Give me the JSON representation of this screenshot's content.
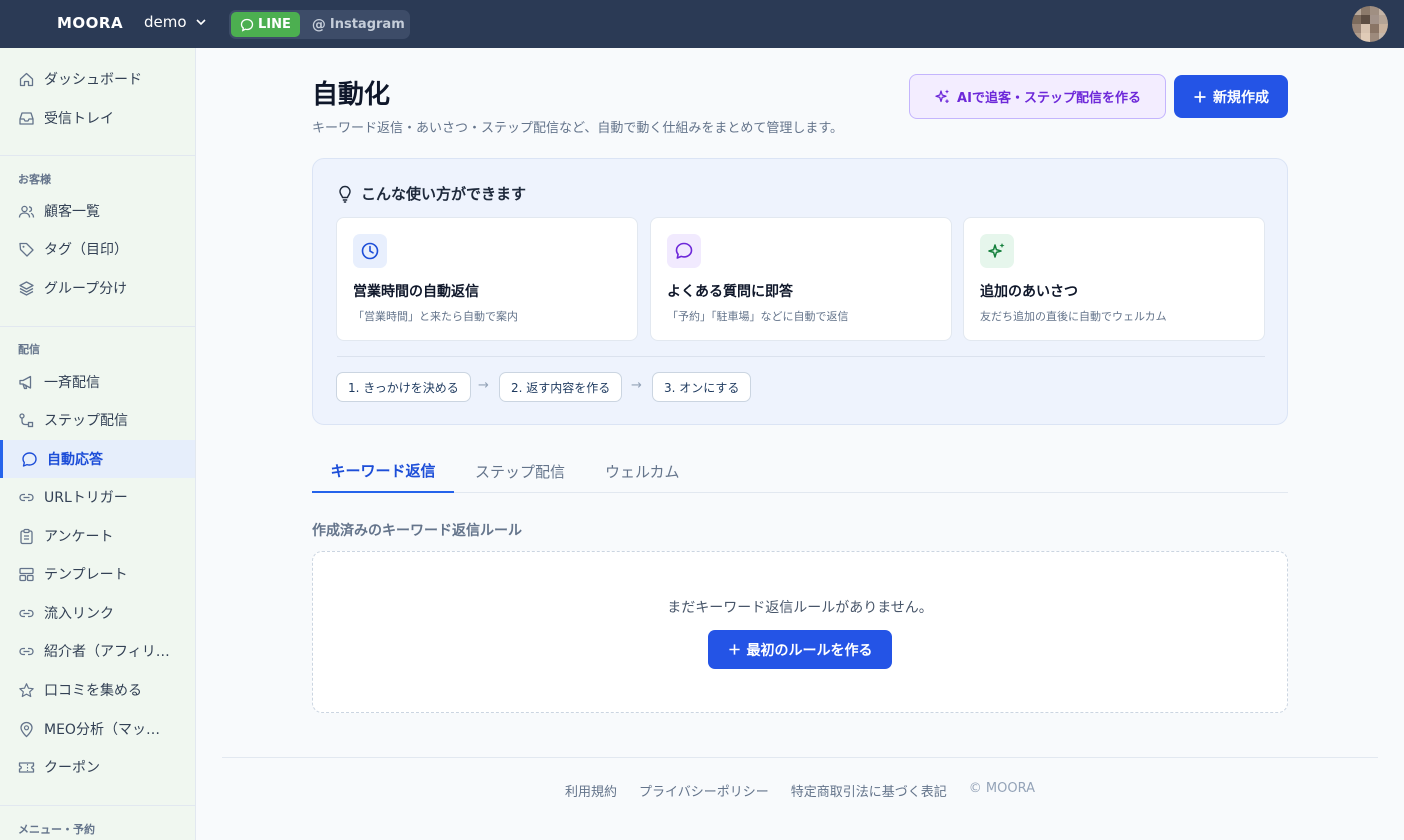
{
  "topbar": {
    "brand": "MOORA",
    "workspace": "demo",
    "channels": {
      "line": "LINE",
      "instagram": "Instagram"
    }
  },
  "sidebar": {
    "items_top": [
      {
        "label": "ダッシュボード",
        "icon": "home-icon"
      },
      {
        "label": "受信トレイ",
        "icon": "inbox-icon"
      }
    ],
    "section_customers": "お客様",
    "items_customers": [
      {
        "label": "顧客一覧",
        "icon": "users-icon"
      },
      {
        "label": "タグ（目印）",
        "icon": "tag-icon"
      },
      {
        "label": "グループ分け",
        "icon": "layers-icon"
      }
    ],
    "section_delivery": "配信",
    "items_delivery": [
      {
        "label": "一斉配信",
        "icon": "megaphone-icon"
      },
      {
        "label": "ステップ配信",
        "icon": "step-icon"
      },
      {
        "label": "自動応答",
        "icon": "chat-icon"
      },
      {
        "label": "URLトリガー",
        "icon": "link-icon"
      },
      {
        "label": "アンケート",
        "icon": "clipboard-icon"
      },
      {
        "label": "テンプレート",
        "icon": "template-icon"
      },
      {
        "label": "流入リンク",
        "icon": "link-icon"
      },
      {
        "label": "紹介者（アフィリエイト）",
        "icon": "link-icon"
      },
      {
        "label": "口コミを集める",
        "icon": "star-icon"
      },
      {
        "label": "MEO分析（マップ）",
        "icon": "map-pin-icon"
      },
      {
        "label": "クーポン",
        "icon": "ticket-icon"
      }
    ],
    "section_menu": "メニュー・予約"
  },
  "header": {
    "title": "自動化",
    "subtitle": "キーワード返信・あいさつ・ステップ配信など、自動で動く仕組みをまとめて管理します。",
    "ai_button": "AIで追客・ステップ配信を作る",
    "new_button": "新規作成"
  },
  "tips": {
    "title": "こんな使い方ができます",
    "cards": [
      {
        "heading": "営業時間の自動返信",
        "desc": "「営業時間」と来たら自動で案内",
        "icon": "clock-icon"
      },
      {
        "heading": "よくある質問に即答",
        "desc": "「予約」「駐車場」などに自動で返信",
        "icon": "chat-bubble-icon"
      },
      {
        "heading": "追加のあいさつ",
        "desc": "友だち追加の直後に自動でウェルカム",
        "icon": "sparkle-icon"
      }
    ],
    "steps": [
      "1. きっかけを決める",
      "2. 返す内容を作る",
      "3. オンにする"
    ]
  },
  "tabs": [
    "キーワード返信",
    "ステップ配信",
    "ウェルカム"
  ],
  "rules": {
    "section_label": "作成済みのキーワード返信ルール",
    "empty_text": "まだキーワード返信ルールがありません。",
    "first_button": "最初のルールを作る"
  },
  "footer": {
    "terms": "利用規約",
    "privacy": "プライバシーポリシー",
    "legal": "特定商取引法に基づく表記",
    "copyright": "© MOORA"
  },
  "colors": {
    "topbar": "#2b3a55",
    "primary": "#2454e6",
    "line_green": "#4caf50",
    "ai_purple": "#6d28d9"
  }
}
